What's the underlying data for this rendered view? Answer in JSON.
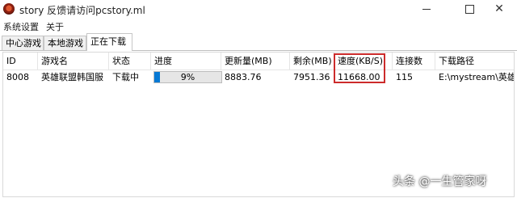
{
  "window": {
    "title": "story 反馈请访问pcstory.ml",
    "icon": "app-globe-icon"
  },
  "menu": [
    "系统设置",
    "关于"
  ],
  "tabs": [
    {
      "label": "中心游戏",
      "active": false
    },
    {
      "label": "本地游戏",
      "active": false
    },
    {
      "label": "正在下载",
      "active": true
    }
  ],
  "table": {
    "columns": [
      "ID",
      "游戏名",
      "状态",
      "进度",
      "更新量(MB)",
      "剩余(MB)",
      "速度(KB/S)",
      "连接数",
      "下载路径"
    ],
    "rows": [
      {
        "id": "8008",
        "name": "英雄联盟韩国服",
        "status": "下载中",
        "progress_text": "9%",
        "progress_value": 0.09,
        "update_mb": "8883.76",
        "remaining_mb": "7951.36",
        "speed": "11668.00",
        "connections": "115",
        "path": "E:\\mystream\\英雄…"
      }
    ]
  },
  "colors": {
    "highlight": "#cc2b2b",
    "progress_fill": "#0679d4"
  },
  "watermark": "头条 @一生管家呀"
}
